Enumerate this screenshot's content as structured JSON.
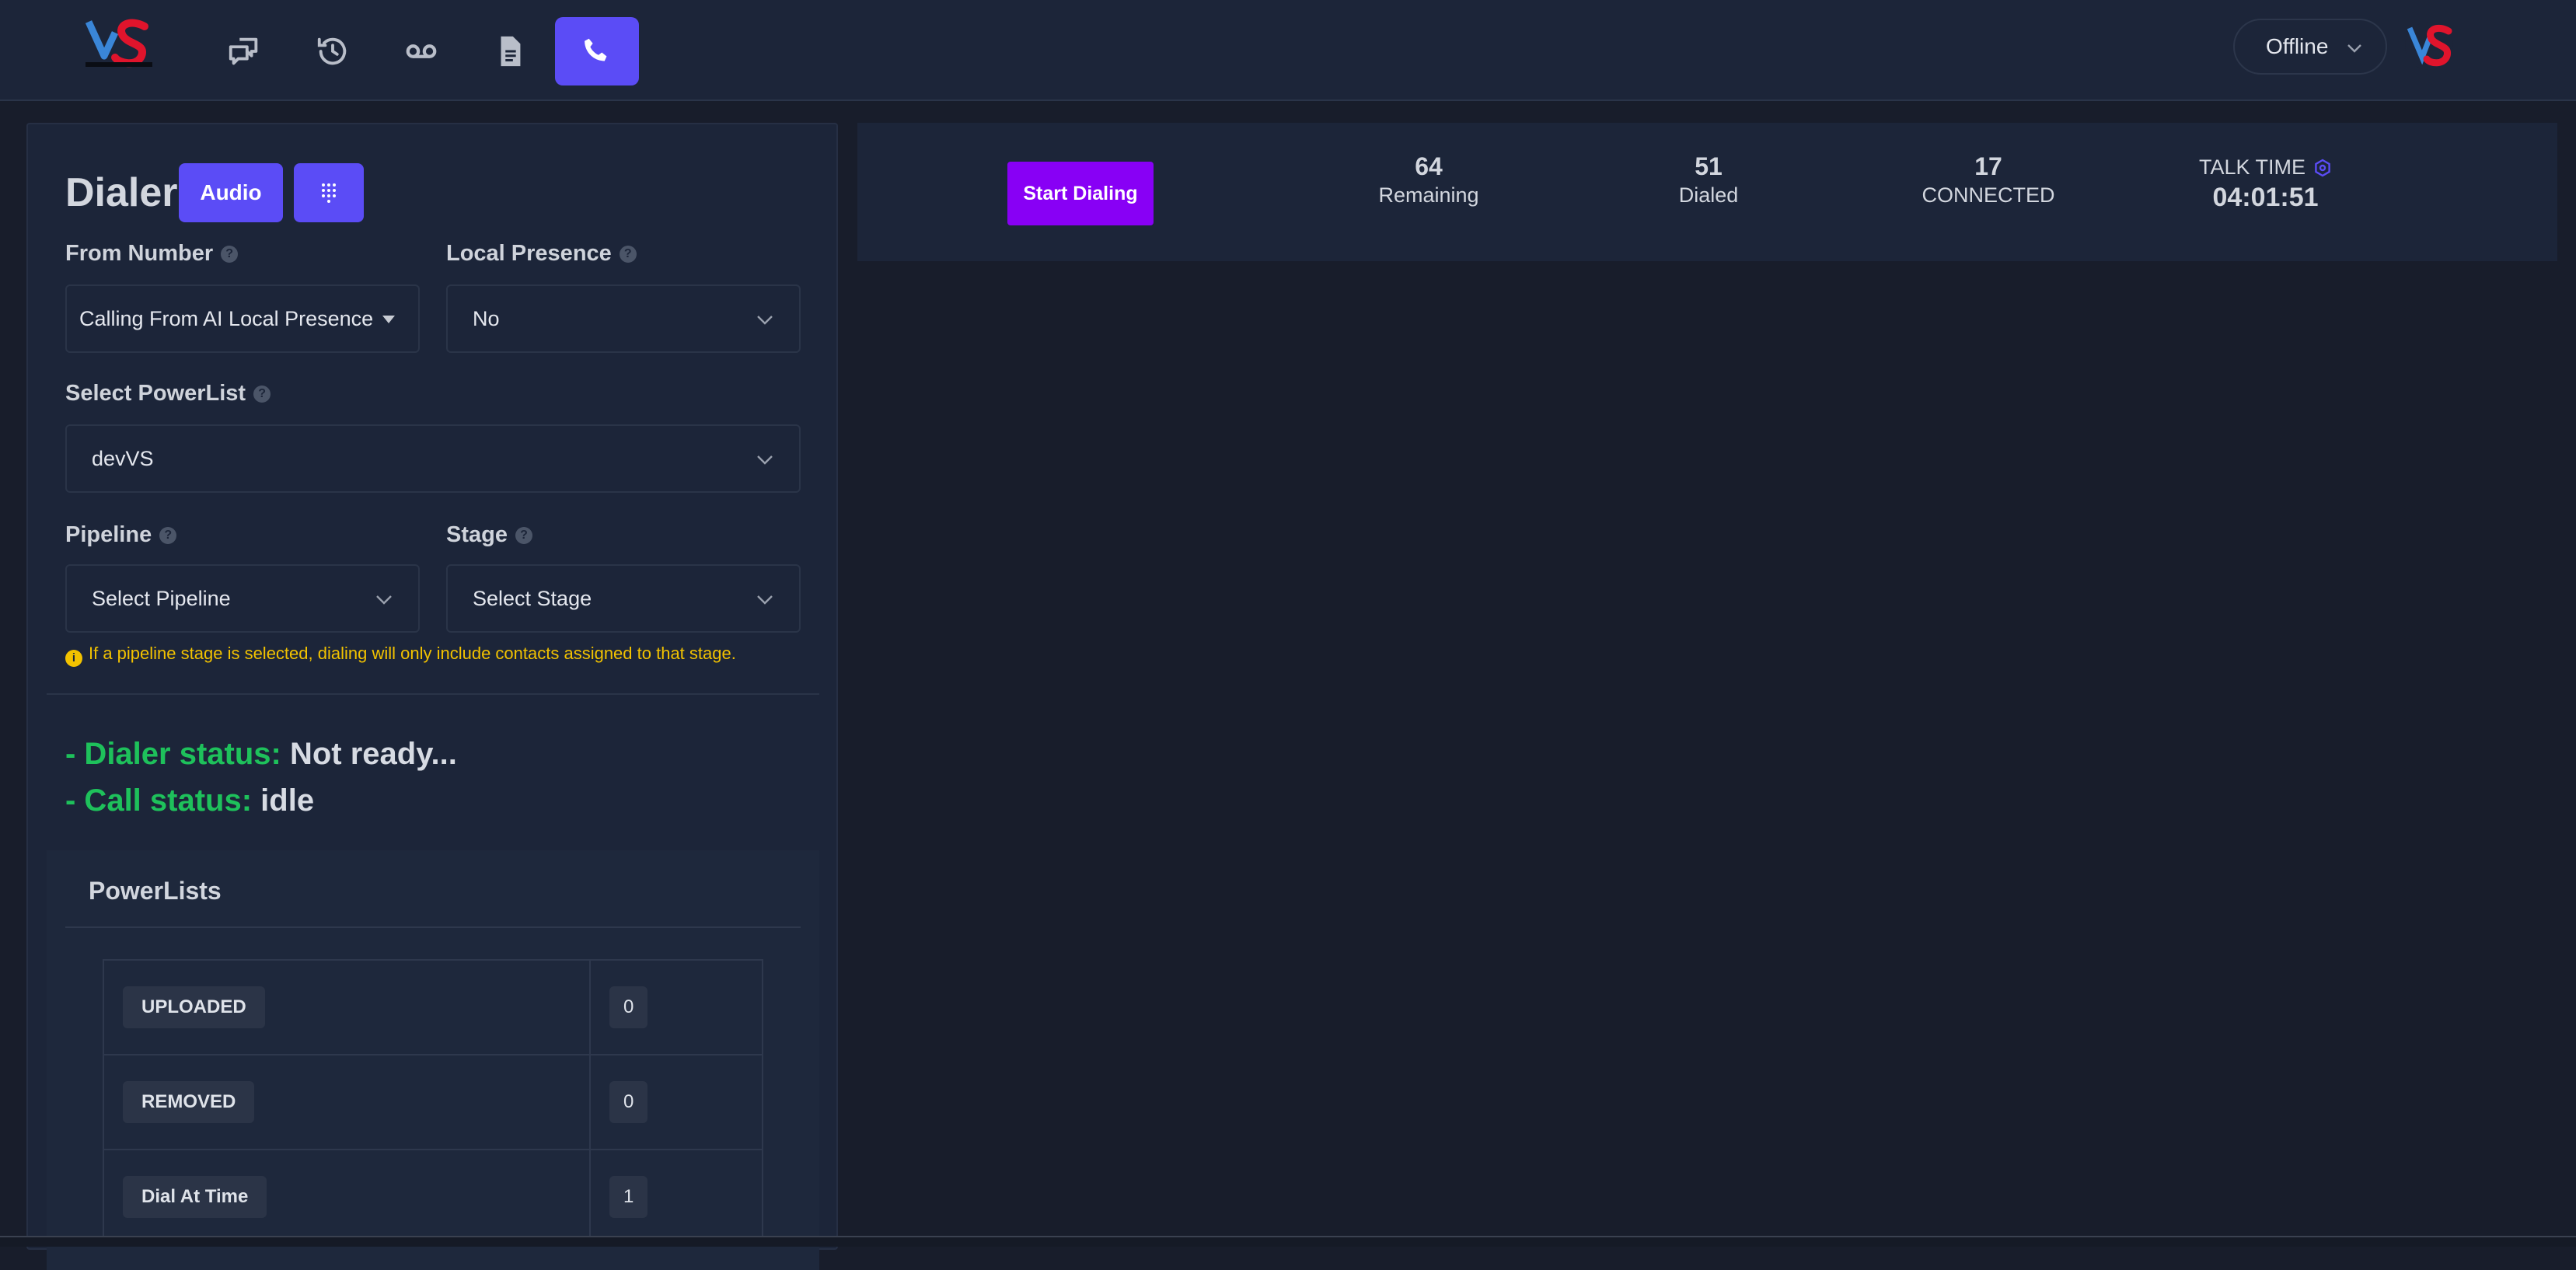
{
  "topbar": {
    "nav_icons": [
      "chat-icon",
      "history-icon",
      "voicemail-icon",
      "document-icon",
      "phone-icon"
    ],
    "active_nav": "phone-icon",
    "status_value": "Offline"
  },
  "dialer": {
    "title": "Dialer",
    "audio_label": "Audio",
    "from_number": {
      "label": "From Number",
      "value": "Calling From AI Local Presence"
    },
    "local_presence": {
      "label": "Local Presence",
      "value": "No"
    },
    "powerlist": {
      "label": "Select PowerList",
      "value": "devVS"
    },
    "pipeline": {
      "label": "Pipeline",
      "value": "Select Pipeline"
    },
    "stage": {
      "label": "Stage",
      "value": "Select Stage"
    },
    "note": "If a pipeline stage is selected, dialing will only include contacts assigned to that stage.",
    "dialer_status": {
      "key": "- Dialer status:",
      "value": "Not ready..."
    },
    "call_status": {
      "key": "- Call status:",
      "value": "idle"
    }
  },
  "powerlists": {
    "title": "PowerLists",
    "rows": [
      {
        "label": "UPLOADED",
        "value": "0"
      },
      {
        "label": "REMOVED",
        "value": "0"
      },
      {
        "label": "Dial At Time",
        "value": "1"
      }
    ]
  },
  "stats": {
    "start_label": "Start Dialing",
    "remaining": {
      "value": "64",
      "label": "Remaining"
    },
    "dialed": {
      "value": "51",
      "label": "Dialed"
    },
    "connected": {
      "value": "17",
      "label": "CONNECTED"
    },
    "talk_time": {
      "label": "TALK TIME",
      "value": "04:01:51"
    }
  },
  "colors": {
    "accent": "#5b4cf6",
    "start_button": "#8800f5",
    "status_key": "#1ec15b",
    "note": "#f2c200",
    "logo_red": "#e0142c"
  }
}
